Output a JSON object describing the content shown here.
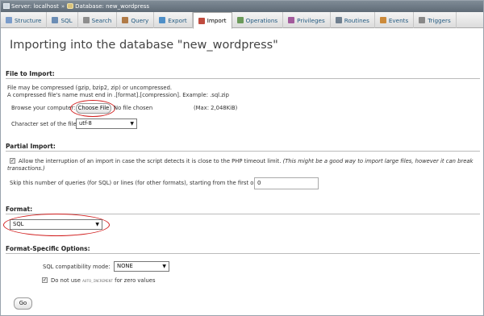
{
  "breadcrumb": {
    "server": "Server: localhost",
    "separator": "»",
    "database": "Database: new_wordpress"
  },
  "tabs": [
    {
      "label": "Structure",
      "icon": "structure-icon",
      "color": "#7a9ccb"
    },
    {
      "label": "SQL",
      "icon": "sql-icon",
      "color": "#6b8db5"
    },
    {
      "label": "Search",
      "icon": "search-icon",
      "color": "#8d8d8d"
    },
    {
      "label": "Query",
      "icon": "query-icon",
      "color": "#b07a46"
    },
    {
      "label": "Export",
      "icon": "export-icon",
      "color": "#4e8fc8"
    },
    {
      "label": "Import",
      "icon": "import-icon",
      "color": "#c04b3e"
    },
    {
      "label": "Operations",
      "icon": "operations-icon",
      "color": "#6b9a5a"
    },
    {
      "label": "Privileges",
      "icon": "privileges-icon",
      "color": "#a25a9c"
    },
    {
      "label": "Routines",
      "icon": "routines-icon",
      "color": "#6f7f8f"
    },
    {
      "label": "Events",
      "icon": "events-icon",
      "color": "#cc8a3a"
    },
    {
      "label": "Triggers",
      "icon": "triggers-icon",
      "color": "#888"
    }
  ],
  "active_tab": "Import",
  "page_title": "Importing into the database \"new_wordpress\"",
  "file_import": {
    "heading": "File to Import:",
    "note1": "File may be compressed (gzip, bzip2, zip) or uncompressed.",
    "note2": "A compressed file's name must end in .[format].[compression]. Example: .sql.zip",
    "browse_label": "Browse your computer:",
    "choose_file": "Choose File",
    "no_file": "No file chosen",
    "max": "(Max: 2,048KiB)",
    "charset_label": "Character set of the file:",
    "charset_value": "utf-8"
  },
  "partial_import": {
    "heading": "Partial Import:",
    "allow_interrupt_text": "Allow the interruption of an import in case the script detects it is close to the PHP timeout limit.",
    "allow_interrupt_note_1": "(This might be a good way to import large files, however it can break",
    "allow_interrupt_note_2": "transactions.)",
    "allow_interrupt_checked": true,
    "skip_label": "Skip this number of queries (for SQL) or lines (for other formats), starting from the first one:",
    "skip_value": "0"
  },
  "format": {
    "heading": "Format:",
    "value": "SQL"
  },
  "format_options": {
    "heading": "Format-Specific Options:",
    "compat_label": "SQL compatibility mode:",
    "compat_value": "NONE",
    "no_auto_label_pre": "Do not use",
    "no_auto_code": "AUTO_INCREMENT",
    "no_auto_label_post": "for zero values",
    "no_auto_checked": true
  },
  "go_button": "Go",
  "highlight_color": "#d11d1d"
}
